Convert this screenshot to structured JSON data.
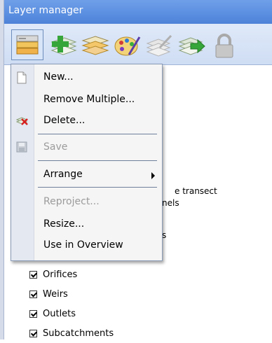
{
  "window": {
    "title": "Layer manager"
  },
  "toolbar": {
    "buttons": [
      {
        "icon": "layer-menu-icon",
        "pressed": true
      },
      {
        "icon": "add-layer-icon"
      },
      {
        "icon": "layers-stack-icon"
      },
      {
        "icon": "palette-icon"
      },
      {
        "icon": "edit-layer-icon"
      },
      {
        "icon": "layer-forward-icon"
      },
      {
        "icon": "lock-icon"
      }
    ]
  },
  "menu": {
    "items": [
      {
        "label": "New...",
        "icon": "new-document-icon",
        "enabled": true
      },
      {
        "label": "Remove Multiple...",
        "enabled": true
      },
      {
        "label": "Delete...",
        "icon": "delete-layer-icon",
        "enabled": true
      },
      {
        "label": "Save",
        "icon": "save-icon",
        "enabled": false
      },
      {
        "label": "Arrange",
        "enabled": true,
        "submenu": true
      },
      {
        "label": "Reproject...",
        "enabled": false
      },
      {
        "label": "Resize...",
        "enabled": true
      },
      {
        "label": "Use in Overview",
        "enabled": true
      }
    ]
  },
  "background": {
    "partial_texts": [
      "e transect",
      "nels",
      "s"
    ]
  },
  "layers": [
    {
      "label": "Orifices",
      "checked": true
    },
    {
      "label": "Weirs",
      "checked": true
    },
    {
      "label": "Outlets",
      "checked": true
    },
    {
      "label": "Subcatchments",
      "checked": true
    }
  ]
}
